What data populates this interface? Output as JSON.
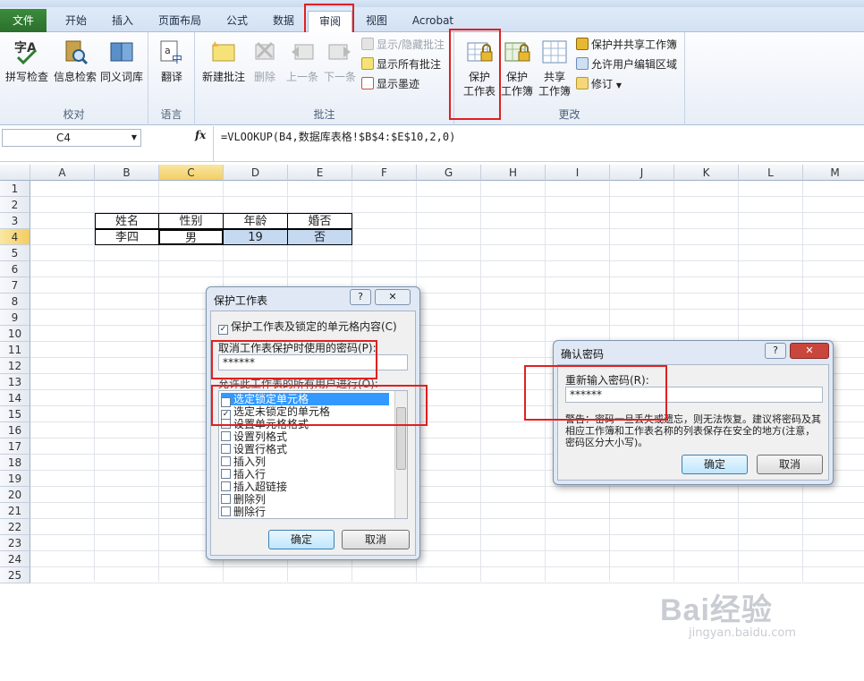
{
  "tabs": [
    "文件",
    "开始",
    "插入",
    "页面布局",
    "公式",
    "数据",
    "审阅",
    "视图",
    "Acrobat"
  ],
  "active_tab": "审阅",
  "ribbon": {
    "proofing": {
      "label": "校对",
      "buttons": [
        "拼写检查",
        "信息检索",
        "同义词库"
      ]
    },
    "language": {
      "label": "语言",
      "buttons": [
        "翻译"
      ]
    },
    "comments": {
      "label": "批注",
      "new_comment": "新建批注",
      "delete": "删除",
      "prev": "上一条",
      "next": "下一条",
      "show_hide": "显示/隐藏批注",
      "show_all": "显示所有批注",
      "show_ink": "显示墨迹"
    },
    "changes": {
      "label": "更改",
      "protect_sheet_line1": "保护",
      "protect_sheet_line2": "工作表",
      "protect_book_line1": "保护",
      "protect_book_line2": "工作簿",
      "share_book_line1": "共享",
      "share_book_line2": "工作簿",
      "protect_share": "保护并共享工作簿",
      "allow_edit": "允许用户编辑区域",
      "track": "修订"
    }
  },
  "formula_bar": {
    "name_box": "C4",
    "fx": "fx",
    "formula": "=VLOOKUP(B4,数据库表格!$B$4:$E$10,2,0)"
  },
  "columns": [
    "A",
    "B",
    "C",
    "D",
    "E",
    "F",
    "G",
    "H",
    "I",
    "J",
    "K",
    "L",
    "M"
  ],
  "rows": [
    "1",
    "2",
    "3",
    "4",
    "5",
    "6",
    "7",
    "8",
    "9",
    "10",
    "11",
    "12",
    "13",
    "14",
    "15",
    "16",
    "17",
    "18",
    "19",
    "20",
    "21",
    "22",
    "23",
    "24",
    "25"
  ],
  "table": {
    "headers": [
      "姓名",
      "性别",
      "年龄",
      "婚否"
    ],
    "values": [
      "李四",
      "男",
      "19",
      "否"
    ]
  },
  "protect_dialog": {
    "title": "保护工作表",
    "help": "?",
    "close": "✕",
    "protect_check": "保护工作表及锁定的单元格内容(C)",
    "password_label": "取消工作表保护时使用的密码(P):",
    "password_value": "******",
    "allow_label": "允许此工作表的所有用户进行(O):",
    "options": [
      "选定锁定单元格",
      "选定未锁定的单元格",
      "设置单元格格式",
      "设置列格式",
      "设置行格式",
      "插入列",
      "插入行",
      "插入超链接",
      "删除列",
      "删除行"
    ],
    "ok": "确定",
    "cancel": "取消"
  },
  "confirm_dialog": {
    "title": "确认密码",
    "help": "?",
    "close": "✕",
    "label": "重新输入密码(R):",
    "value": "******",
    "warning": "警告：密码一旦丢失或遗忘，则无法恢复。建议将密码及其相应工作簿和工作表名称的列表保存在安全的地方(注意，密码区分大小写)。",
    "ok": "确定",
    "cancel": "取消"
  },
  "watermark": {
    "brand": "Bai经验",
    "url": "jingyan.baidu.com"
  }
}
